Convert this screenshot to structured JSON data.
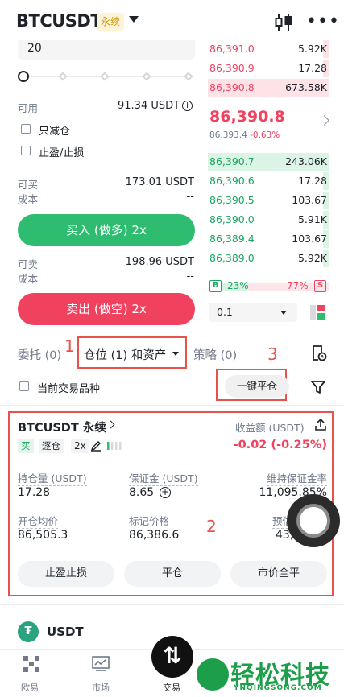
{
  "header": {
    "symbol": "BTCUSDT",
    "badge": "永续"
  },
  "form": {
    "quantity": "20",
    "available_label": "可用",
    "available_value": "91.34 USDT",
    "reduce_only": "只减仓",
    "tp_sl": "止盈/止损",
    "can_buy_label": "可买",
    "can_buy_value": "173.01 USDT",
    "cost_label": "成本",
    "cost_buy_value": "--",
    "buy_button": "买入 (做多) 2x",
    "can_sell_label": "可卖",
    "can_sell_value": "198.96 USDT",
    "cost_sell_value": "--",
    "sell_button": "卖出 (做空) 2x",
    "slider_level": 0
  },
  "orderbook": {
    "asks": [
      {
        "price": "86,391.0",
        "qty": "5.92K",
        "depth": 0.05
      },
      {
        "price": "86,390.9",
        "qty": "17.28",
        "depth": 0.05
      },
      {
        "price": "86,390.8",
        "qty": "673.58K",
        "depth": 1.0
      }
    ],
    "last_price": "86,390.8",
    "mark_price": "86,393.4",
    "change": "-0.63%",
    "bids": [
      {
        "price": "86,390.7",
        "qty": "243.06K",
        "depth": 1.0
      },
      {
        "price": "86,390.6",
        "qty": "17.28",
        "depth": 0.05
      },
      {
        "price": "86,390.5",
        "qty": "103.67",
        "depth": 0.05
      },
      {
        "price": "86,390.0",
        "qty": "5.91K",
        "depth": 0.05
      },
      {
        "price": "86,389.4",
        "qty": "103.67",
        "depth": 0.05
      },
      {
        "price": "86,389.0",
        "qty": "5.92K",
        "depth": 0.05
      }
    ],
    "buy_letter": "B",
    "buy_pct": "23%",
    "sell_pct": "77%",
    "sell_letter": "S",
    "depth_value": "0.1"
  },
  "tabs": {
    "orders": "委托 (0)",
    "positions": "仓位 (1) 和资产",
    "strategies": "策略 (0)"
  },
  "filter": {
    "current_symbol": "当前交易品种",
    "close_all": "一键平仓"
  },
  "annotations": {
    "n1": "1",
    "n2": "2",
    "n3": "3"
  },
  "position": {
    "symbol": "BTCUSDT 永续",
    "side": "买",
    "margin_mode": "逐仓",
    "leverage": "2x",
    "pnl_label": "收益额 (USDT)",
    "pnl_value": "-0.02 (-0.25%)",
    "size_label": "持仓量 (USDT)",
    "size_value": "17.28",
    "margin_label": "保证金 (USDT)",
    "margin_value": "8.65",
    "mm_label": "维持保证金率",
    "mm_value": "11,095.85%",
    "entry_label": "开仓均价",
    "entry_value": "86,505.3",
    "mark_label": "标记价格",
    "mark_value": "86,386.6",
    "liq_label": "预估",
    "liq_value": "43,",
    "btn_tpsl": "止盈止损",
    "btn_close": "平仓",
    "btn_market_close": "市价全平"
  },
  "asset": {
    "name": "USDT"
  },
  "nav": {
    "overview": "欧易",
    "market": "市场",
    "trade": "交易"
  },
  "watermark": {
    "text": "轻松科技",
    "sub": "YNQINGSONG.COM"
  },
  "colors": {
    "buy": "#2ebd70",
    "sell": "#f0425f",
    "badge": "#c99400",
    "annotation": "#e5534b"
  }
}
